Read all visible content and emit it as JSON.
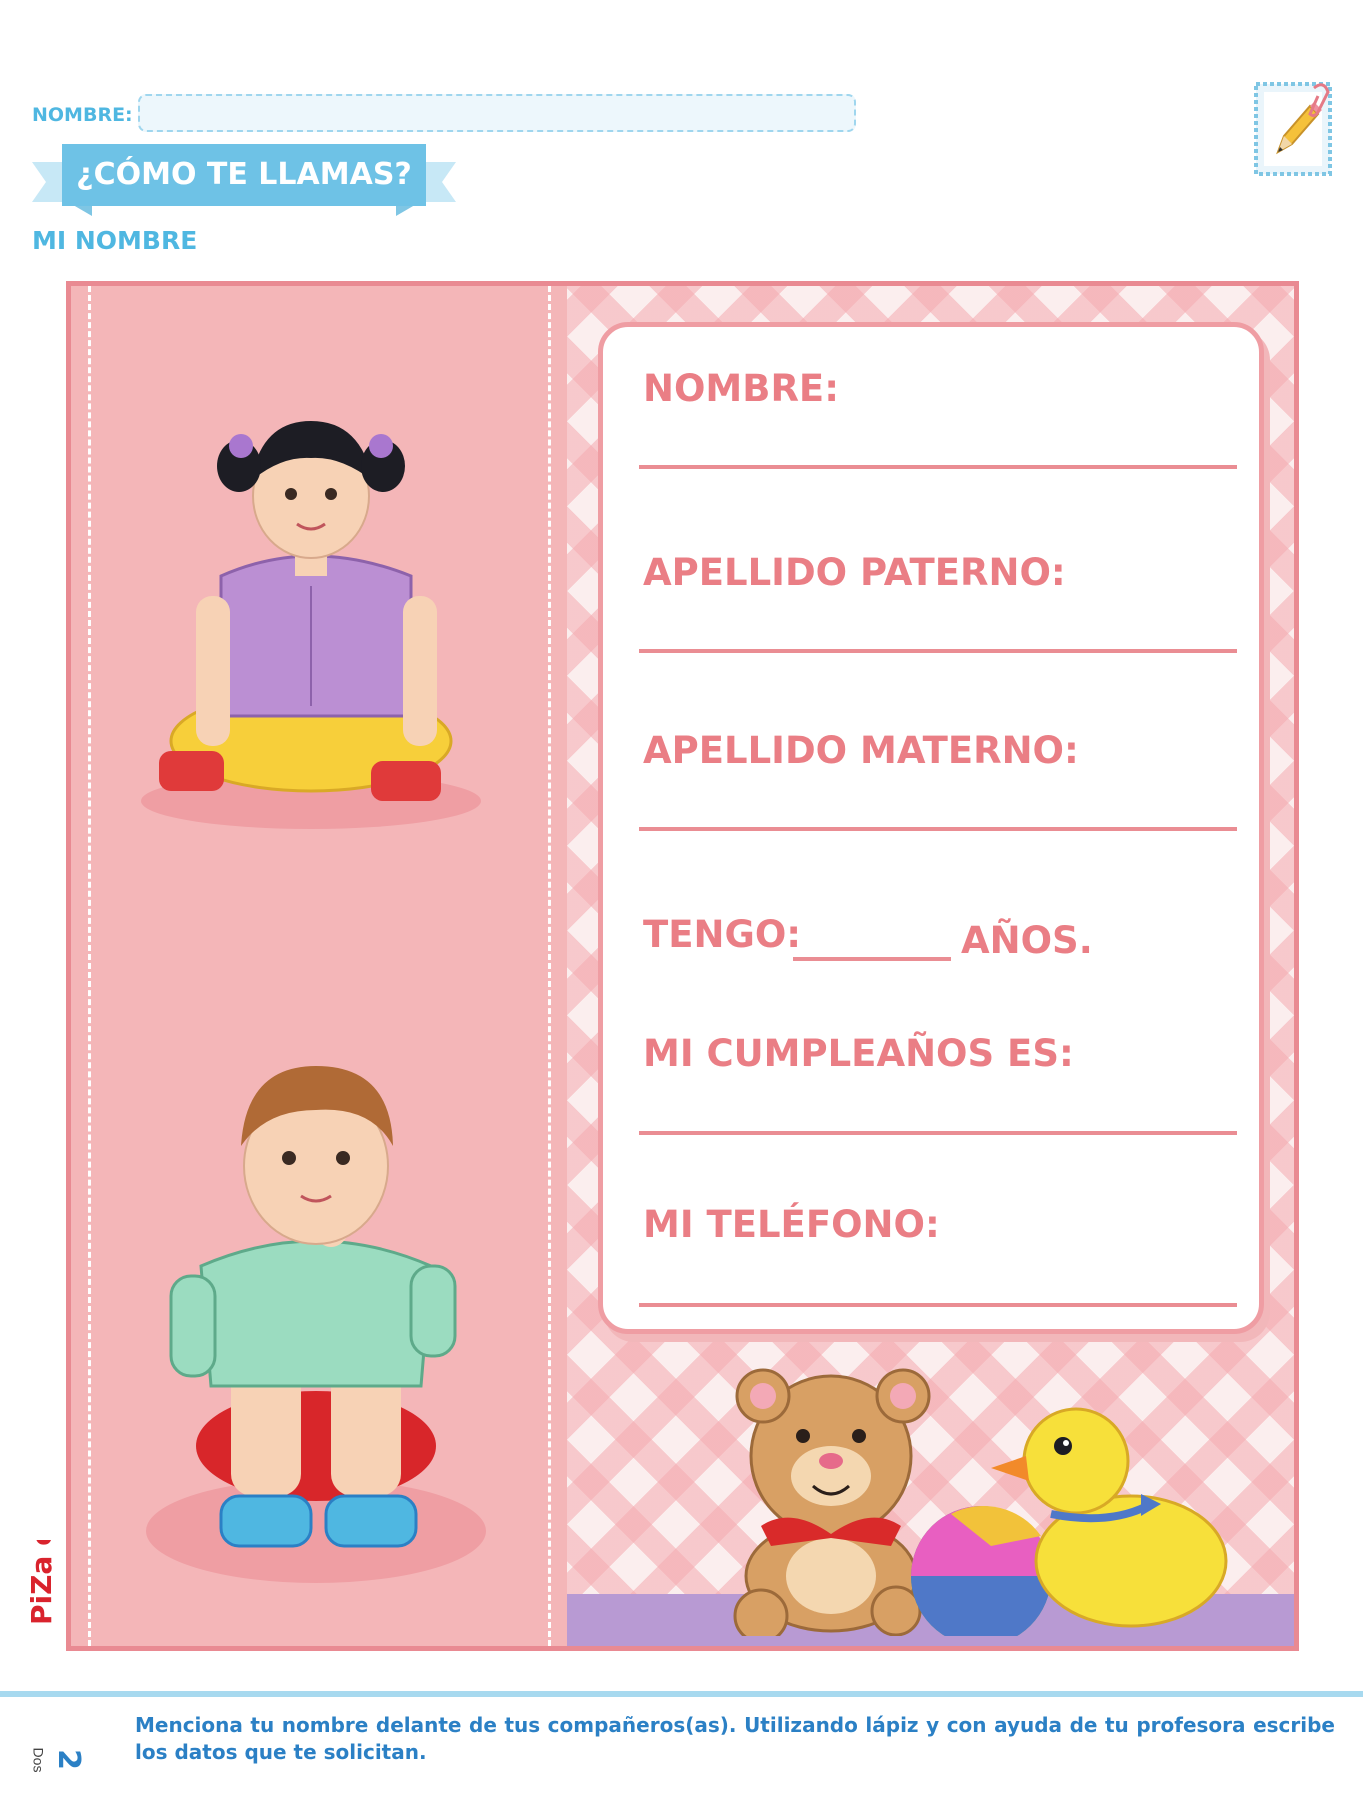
{
  "header": {
    "name_label": "NOMBRE:",
    "ribbon_title": "¿CÓMO TE LLAMAS?",
    "subtitle": "MI NOMBRE"
  },
  "form": {
    "fields": [
      {
        "label": "NOMBRE:"
      },
      {
        "label": "APELLIDO PATERNO:"
      },
      {
        "label": "APELLIDO MATERNO:"
      },
      {
        "label": "MI CUMPLEAÑOS ES:"
      },
      {
        "label": "MI TELÉFONO:"
      }
    ],
    "age_prefix": "TENGO:",
    "age_suffix": "AÑOS."
  },
  "footer": {
    "instructions": "Menciona tu nombre delante de tus compañeros(as). Utilizando lápiz y con ayuda de tu profesora escribe los datos que te solicitan.",
    "page_number": "2",
    "page_word": "Dos"
  },
  "logo": {
    "text": "PiZa ediciones"
  },
  "icons": [
    "pencil-icon",
    "paperclip-icon"
  ],
  "colors": {
    "accent_blue": "#4fb7e1",
    "label_pink": "#ea7e85",
    "panel_pink": "#f4b6b8",
    "floor_purple": "#b89ad3",
    "footer_blue": "#2b80c5"
  }
}
